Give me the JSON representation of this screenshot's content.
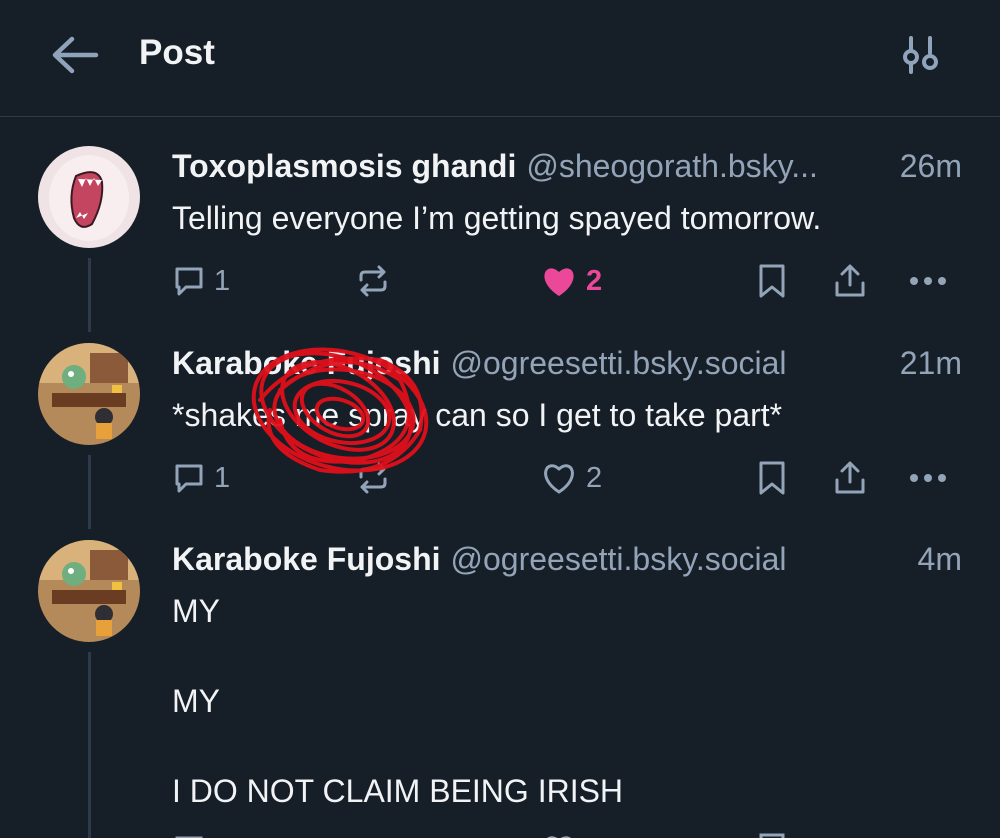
{
  "header": {
    "title": "Post",
    "back_icon": "arrow-left-icon",
    "settings_icon": "sliders-icon"
  },
  "posts": [
    {
      "author": "Toxoplasmosis ghandi",
      "handle": "@sheogorath.bsky...",
      "time": "26m",
      "text": "Telling everyone I’m getting spayed tomorrow.",
      "reply_count": "1",
      "like_count": "2",
      "liked": true,
      "avatar_icon": "screaming-face-avatar"
    },
    {
      "author": "Karaboke Fujoshi",
      "handle": "@ogreesetti.bsky.social",
      "time": "21m",
      "text": "*shakes me spray can so I get to take part*",
      "reply_count": "1",
      "like_count": "2",
      "liked": false,
      "avatar_icon": "cartoon-room-avatar",
      "annotation": "red-scribble-over-text"
    },
    {
      "author": "Karaboke Fujoshi",
      "handle": "@ogreesetti.bsky.social",
      "time": "4m",
      "lines": [
        "MY",
        "MY",
        "I DO NOT CLAIM BEING IRISH"
      ],
      "avatar_icon": "cartoon-room-avatar"
    }
  ],
  "colors": {
    "background": "#161e27",
    "muted": "#93a4b8",
    "like": "#ec4899",
    "divider": "#2c3a4b",
    "scribble": "#e0101a"
  }
}
